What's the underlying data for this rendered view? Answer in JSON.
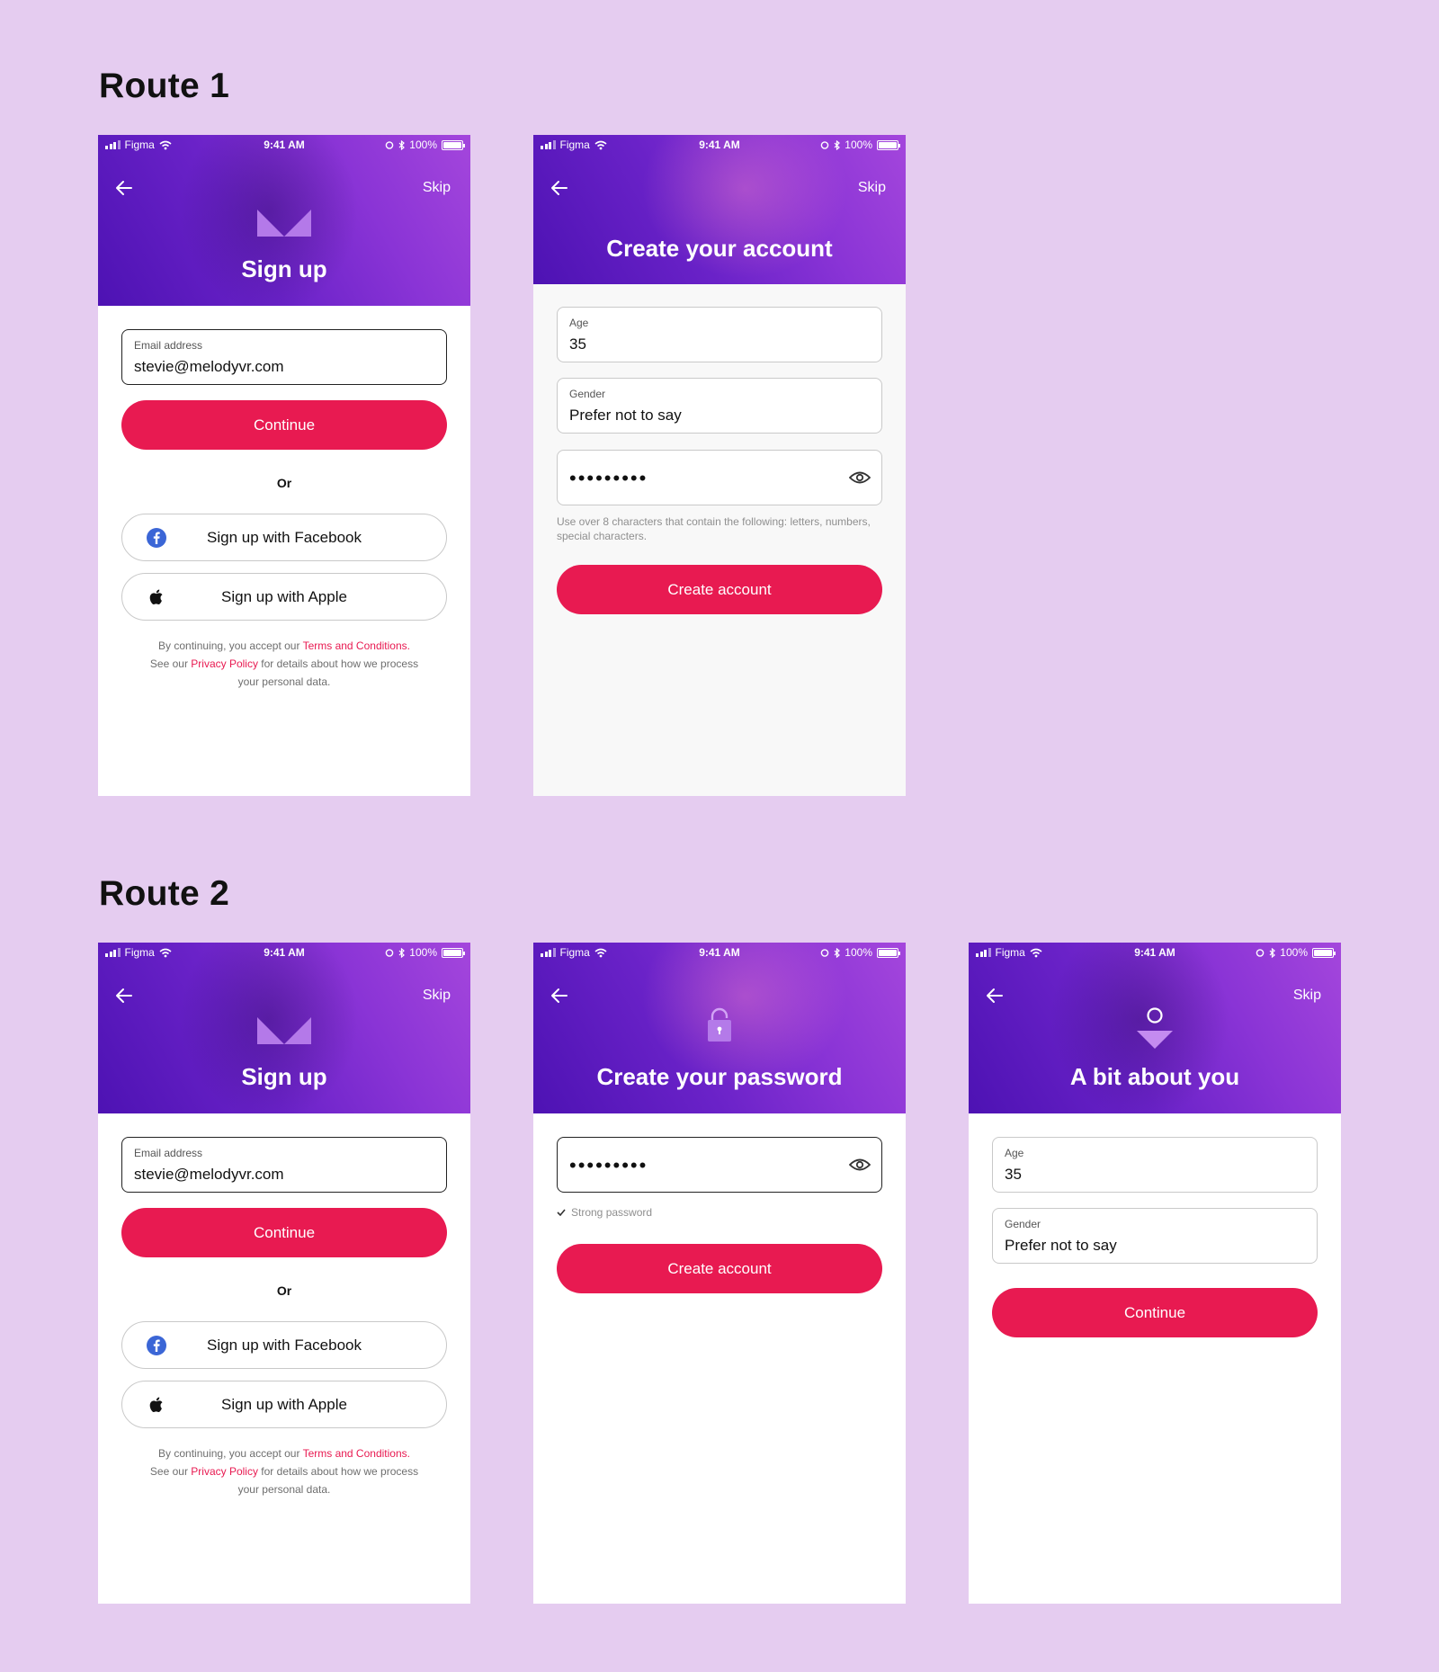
{
  "routes": [
    {
      "title": "Route 1"
    },
    {
      "title": "Route 2"
    }
  ],
  "status_bar": {
    "carrier": "Figma",
    "time": "9:41 AM",
    "battery": "100%"
  },
  "common": {
    "skip_label": "Skip",
    "continue_label": "Continue",
    "create_account_label": "Create account"
  },
  "signup": {
    "title": "Sign up",
    "email_label": "Email address",
    "email_value": "stevie@melodyvr.com",
    "or_label": "Or",
    "facebook_label": "Sign up with Facebook",
    "apple_label": "Sign up with Apple",
    "legal": {
      "line1_prefix": "By continuing, you accept our ",
      "terms_link": "Terms and Conditions.",
      "line2_prefix": "See our ",
      "privacy_link": "Privacy Policy",
      "line2_suffix": " for details about how we process",
      "line3": "your personal data."
    }
  },
  "create_account": {
    "title": "Create your account",
    "age_label": "Age",
    "age_value": "35",
    "gender_label": "Gender",
    "gender_value": "Prefer not to say",
    "password_mask": "•••••••••",
    "hint": "Use over 8 characters that contain the following: letters, numbers, special characters."
  },
  "create_password": {
    "title": "Create your password",
    "password_mask": "•••••••••",
    "strength_text": "Strong password"
  },
  "about_you": {
    "title": "A bit about you",
    "age_label": "Age",
    "age_value": "35",
    "gender_label": "Gender",
    "gender_value": "Prefer not to say"
  },
  "colors": {
    "background": "#e5ccf0",
    "accent": "#e81a51",
    "hero_start": "#4d12b3",
    "hero_end": "#a446dc",
    "facebook": "#3b66d6"
  },
  "icons": [
    "back-arrow-icon",
    "melody-logo-icon",
    "eye-icon",
    "facebook-icon",
    "apple-icon",
    "lock-icon",
    "person-icon",
    "check-icon",
    "signal-icon",
    "wifi-icon",
    "alarm-icon",
    "bluetooth-icon",
    "battery-icon"
  ]
}
